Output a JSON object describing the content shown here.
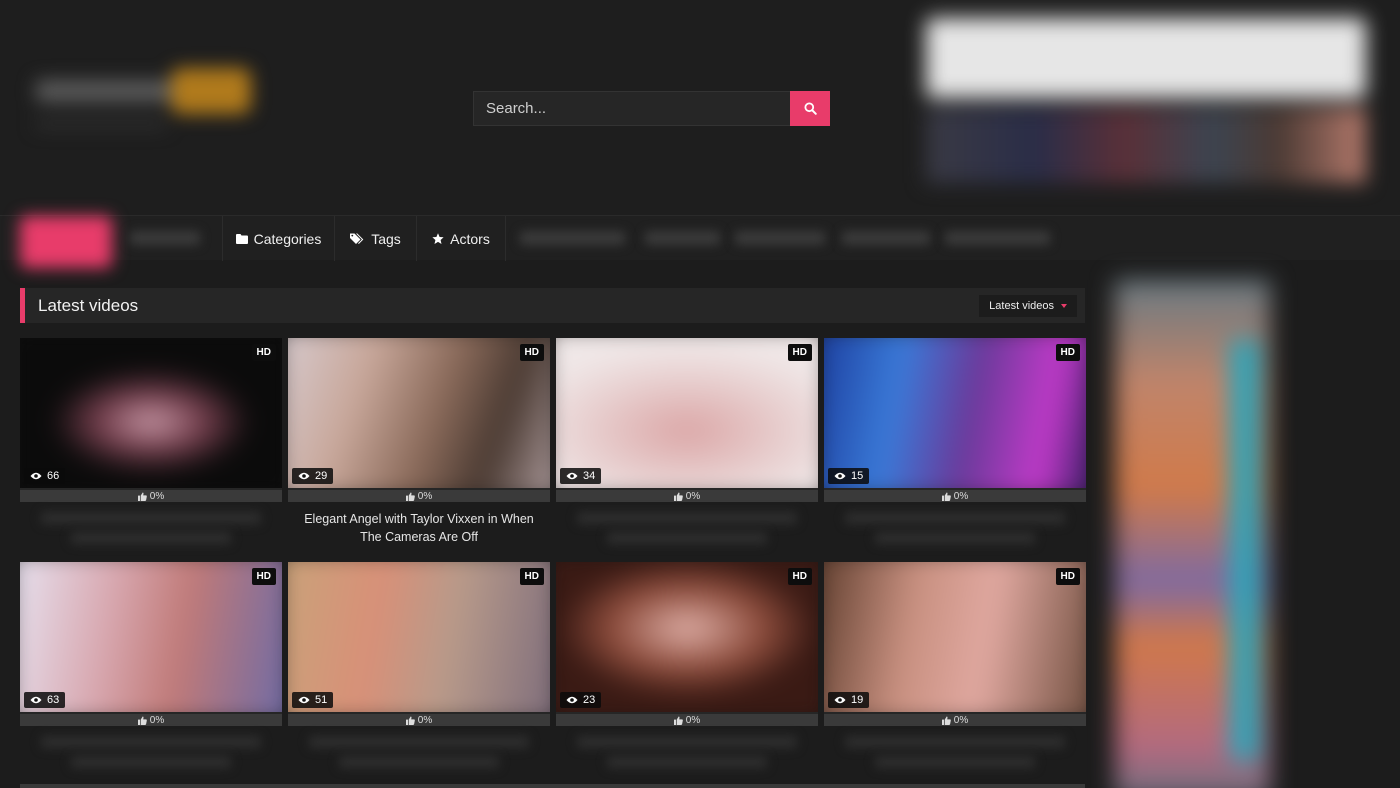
{
  "search": {
    "placeholder": "Search..."
  },
  "nav": {
    "items": [
      {
        "label": "Categories",
        "icon": "folder-icon"
      },
      {
        "label": "Tags",
        "icon": "tags-icon"
      },
      {
        "label": "Actors",
        "icon": "star-icon"
      }
    ]
  },
  "section": {
    "title": "Latest videos",
    "sort_label": "Latest videos"
  },
  "videos": [
    {
      "badge": "HD",
      "views": "66",
      "rating": "0%",
      "title": ""
    },
    {
      "badge": "HD",
      "views": "29",
      "rating": "0%",
      "title": "Elegant Angel with Taylor Vixxen in When The Cameras Are Off"
    },
    {
      "badge": "HD",
      "views": "34",
      "rating": "0%",
      "title": ""
    },
    {
      "badge": "HD",
      "views": "15",
      "rating": "0%",
      "title": ""
    },
    {
      "badge": "HD",
      "views": "63",
      "rating": "0%",
      "title": ""
    },
    {
      "badge": "HD",
      "views": "51",
      "rating": "0%",
      "title": ""
    },
    {
      "badge": "HD",
      "views": "23",
      "rating": "0%",
      "title": ""
    },
    {
      "badge": "HD",
      "views": "19",
      "rating": "0%",
      "title": ""
    }
  ],
  "colors": {
    "accent": "#e83c6a",
    "background": "#1c1c1c"
  }
}
